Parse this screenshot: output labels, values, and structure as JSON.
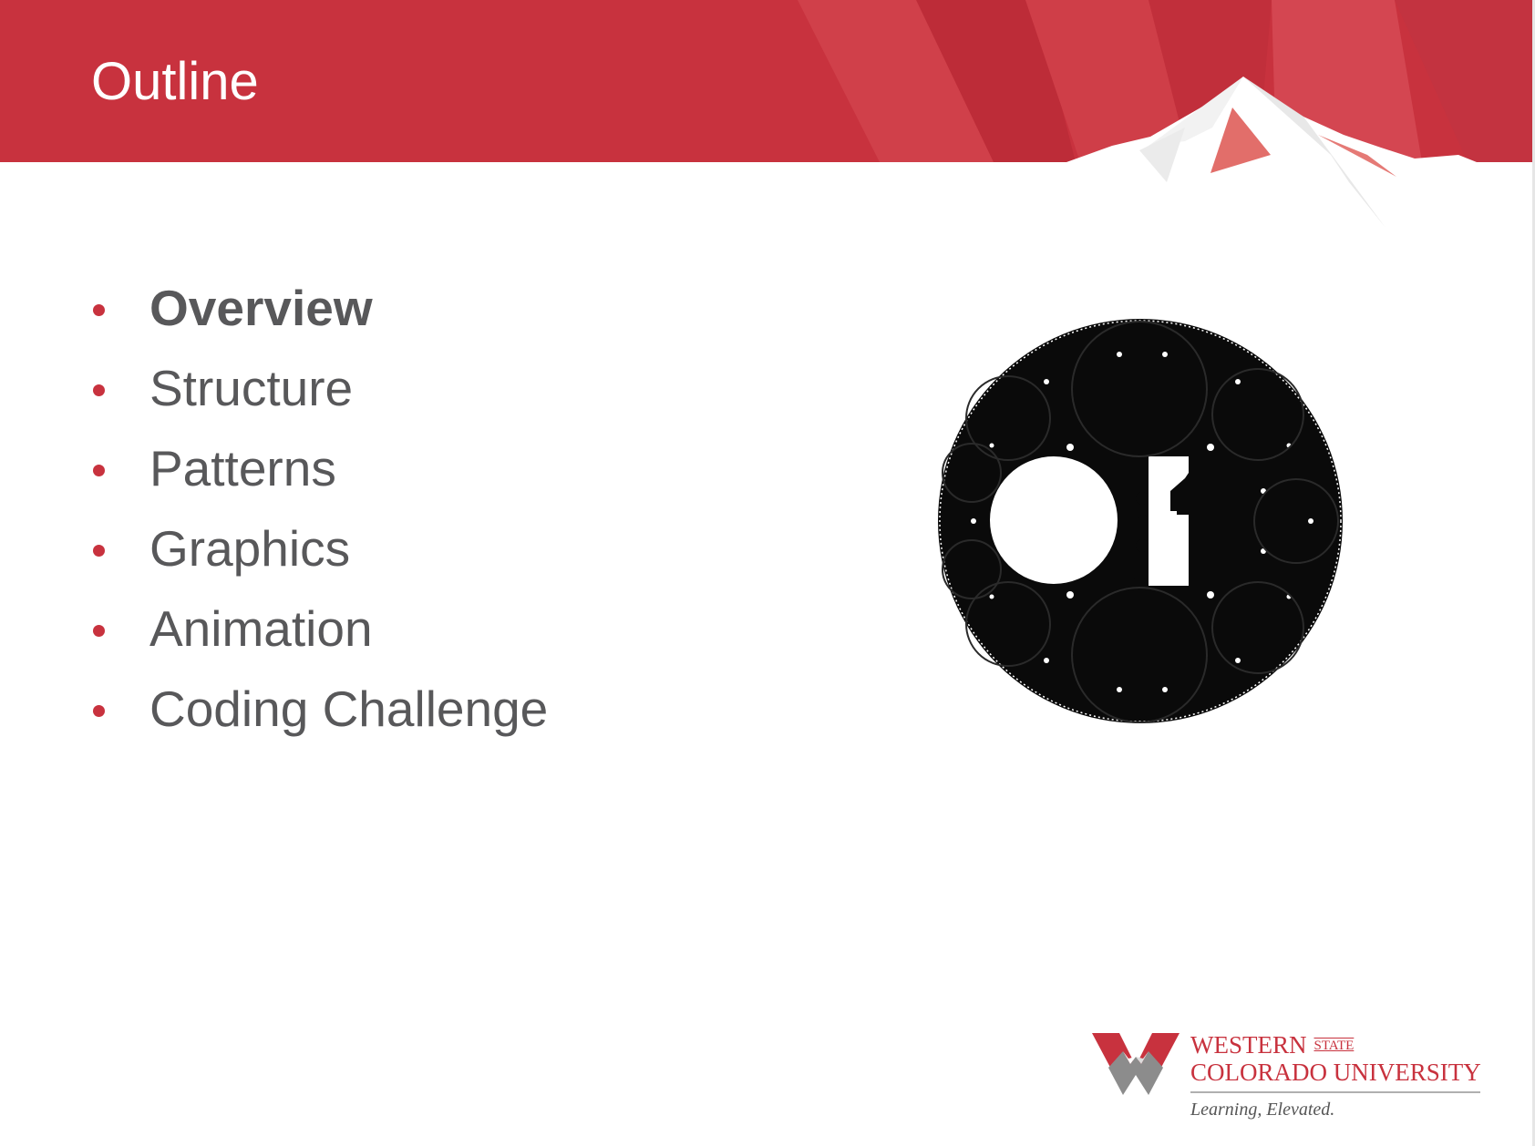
{
  "slide": {
    "title": "Outline",
    "bullets": [
      {
        "label": "Overview",
        "bold": true
      },
      {
        "label": "Structure",
        "bold": false
      },
      {
        "label": "Patterns",
        "bold": false
      },
      {
        "label": "Graphics",
        "bold": false
      },
      {
        "label": "Animation",
        "bold": false
      },
      {
        "label": "Coding Challenge",
        "bold": false
      }
    ]
  },
  "logo": {
    "line1": "WESTERN",
    "state": "STATE",
    "line2": "COLORADO UNIVERSITY",
    "tagline": "Learning, Elevated."
  },
  "colors": {
    "banner": "#c8323e",
    "accent": "#c8323e",
    "text": "#58585a"
  },
  "icons": {
    "picture": "circle-packing-image",
    "logo_mark": "w-mountain-logo-icon"
  }
}
